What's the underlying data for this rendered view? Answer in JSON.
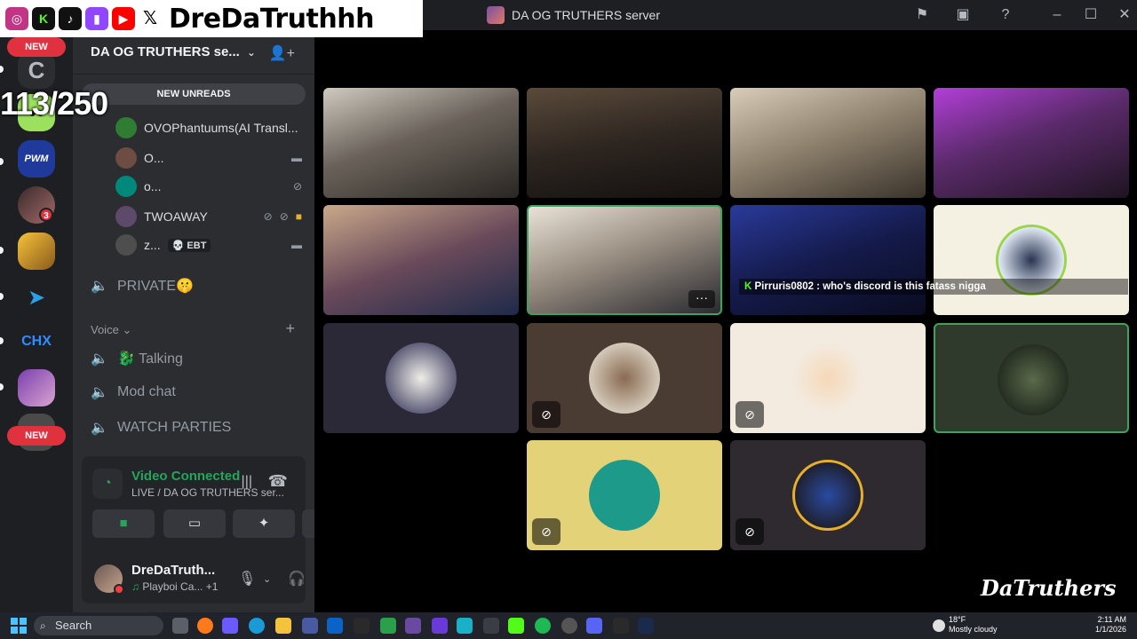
{
  "window": {
    "title": "DA OG TRUTHERS server",
    "controls": [
      "minimize-icon",
      "maximize-icon",
      "close-icon"
    ]
  },
  "overlay": {
    "handle": "DreDaTruthhh",
    "socials": [
      "instagram-icon",
      "kick-icon",
      "tiktok-icon",
      "twitch-icon",
      "youtube-icon",
      "x-icon"
    ],
    "counter": "113/250",
    "watermark": "DaTruthers"
  },
  "rail": {
    "new_badge_top": "NEW",
    "new_badge_bottom": "NEW",
    "mention_count": "3",
    "chx_label": "CHX",
    "pwm_label": "PWM"
  },
  "sidebar": {
    "server_name": "DA OG TRUTHERS se...",
    "new_unreads": "NEW UNREADS",
    "voice_users": [
      {
        "name": "OVOPhantuums(AI Transl...",
        "color": "#2e7d32"
      },
      {
        "name": "O...",
        "color": "#6d4c41"
      },
      {
        "name": "o...",
        "color": "#00897b"
      },
      {
        "name": "TWOAWAY",
        "color": "#5d4a6a"
      },
      {
        "name": "z...",
        "color": "#4e4e4e",
        "tag": "💀 EBT"
      }
    ],
    "private_channel": "PRIVATE🤫",
    "voice_category": "Voice",
    "voice_channels": [
      "🐉 Talking",
      "Mod chat",
      "WATCH PARTIES"
    ]
  },
  "voice_panel": {
    "status": "Video Connected",
    "location": "LIVE / DA OG TRUTHERS ser..."
  },
  "user_panel": {
    "name": "DreDaTruth...",
    "activity": "Playboi Ca...",
    "activity_extra": "+1"
  },
  "stage": {
    "chat_overlay": "Pirruris0802 : who's discord is this fatass nigga",
    "tiles": [
      {
        "id": "cam-1",
        "kind": "camera"
      },
      {
        "id": "cam-2",
        "kind": "camera"
      },
      {
        "id": "cam-3",
        "kind": "camera"
      },
      {
        "id": "cam-4",
        "kind": "camera"
      },
      {
        "id": "cam-5",
        "kind": "camera"
      },
      {
        "id": "cam-6",
        "kind": "camera",
        "speaking": true
      },
      {
        "id": "cam-7",
        "kind": "camera"
      },
      {
        "id": "avatar-8",
        "kind": "avatar",
        "bg": "#f4f0e2"
      },
      {
        "id": "avatar-9",
        "kind": "avatar",
        "bg": "#2b2838"
      },
      {
        "id": "avatar-10",
        "kind": "avatar",
        "bg": "#4a3b33",
        "muted": true
      },
      {
        "id": "avatar-11",
        "kind": "avatar",
        "bg": "#f3ebe0",
        "muted": true
      },
      {
        "id": "avatar-12",
        "kind": "avatar",
        "bg": "#2f3a2c",
        "speaking": true
      },
      {
        "id": "avatar-13",
        "kind": "avatar",
        "bg": "#e3d278",
        "muted": true
      },
      {
        "id": "avatar-14",
        "kind": "avatar",
        "bg": "#2e2a2f",
        "muted": true
      }
    ]
  },
  "taskbar": {
    "search_label": "Search",
    "weather_temp": "18°F",
    "weather_desc": "Mostly cloudy",
    "time": "2:11 AM",
    "date": "1/1/2026"
  },
  "colors": {
    "accent_green": "#23a55a",
    "alert_red": "#e0313e",
    "sidebar_bg": "#2b2d31",
    "rail_bg": "#1e1f22"
  }
}
